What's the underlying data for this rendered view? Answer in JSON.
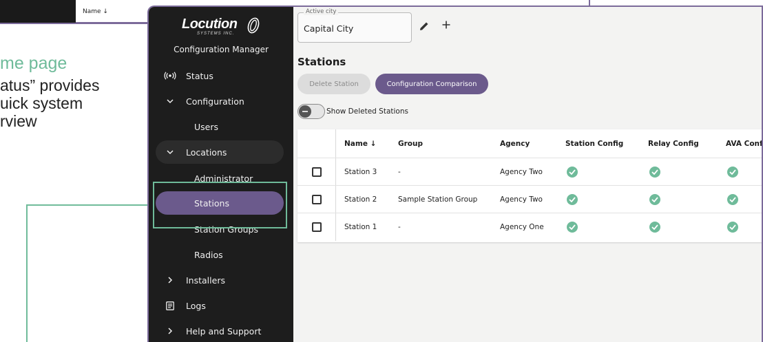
{
  "background": {
    "prev_table_header": "Name ↓",
    "heading": "me page",
    "body_lines": [
      "atus” provides",
      "uick system",
      "rview"
    ]
  },
  "app": {
    "brand_name": "Locution",
    "brand_sub": "SYSTEMS INC.",
    "app_name": "Configuration Manager"
  },
  "nav": {
    "status": "Status",
    "configuration": "Configuration",
    "users": "Users",
    "locations": "Locations",
    "administrator": "Administrator",
    "stations": "Stations",
    "station_groups": "Station Groups",
    "radios": "Radios",
    "installers": "Installers",
    "logs": "Logs",
    "help": "Help and Support"
  },
  "city": {
    "label": "Active city",
    "value": "Capital City"
  },
  "page": {
    "title": "Stations",
    "delete_label": "Delete Station",
    "compare_label": "Configuration Comparison",
    "show_deleted_label": "Show Deleted Stations",
    "show_deleted_on": false
  },
  "table": {
    "columns": [
      "Name ↓",
      "Group",
      "Agency",
      "Station Config",
      "Relay Config",
      "AVA Confi"
    ],
    "rows": [
      {
        "name": "Station 3",
        "group": "-",
        "agency": "Agency Two",
        "station_config": "ok",
        "relay_config": "ok",
        "ava_config": "ok"
      },
      {
        "name": "Station 2",
        "group": "Sample Station Group",
        "agency": "Agency Two",
        "station_config": "ok",
        "relay_config": "ok",
        "ava_config": "ok"
      },
      {
        "name": "Station 1",
        "group": "-",
        "agency": "Agency One",
        "station_config": "ok",
        "relay_config": "ok",
        "ava_config": "ok"
      }
    ]
  },
  "colors": {
    "accent": "#6b5a8c",
    "success": "#6fbb9a",
    "sidebar_bg": "#1d1d1d"
  },
  "icons": {
    "status": "broadcast-icon",
    "expand": "chevron-down-icon",
    "collapse": "chevron-right-icon",
    "logs": "document-list-icon",
    "edit": "pencil-icon",
    "add": "plus-icon",
    "ok": "check-circle-icon"
  }
}
